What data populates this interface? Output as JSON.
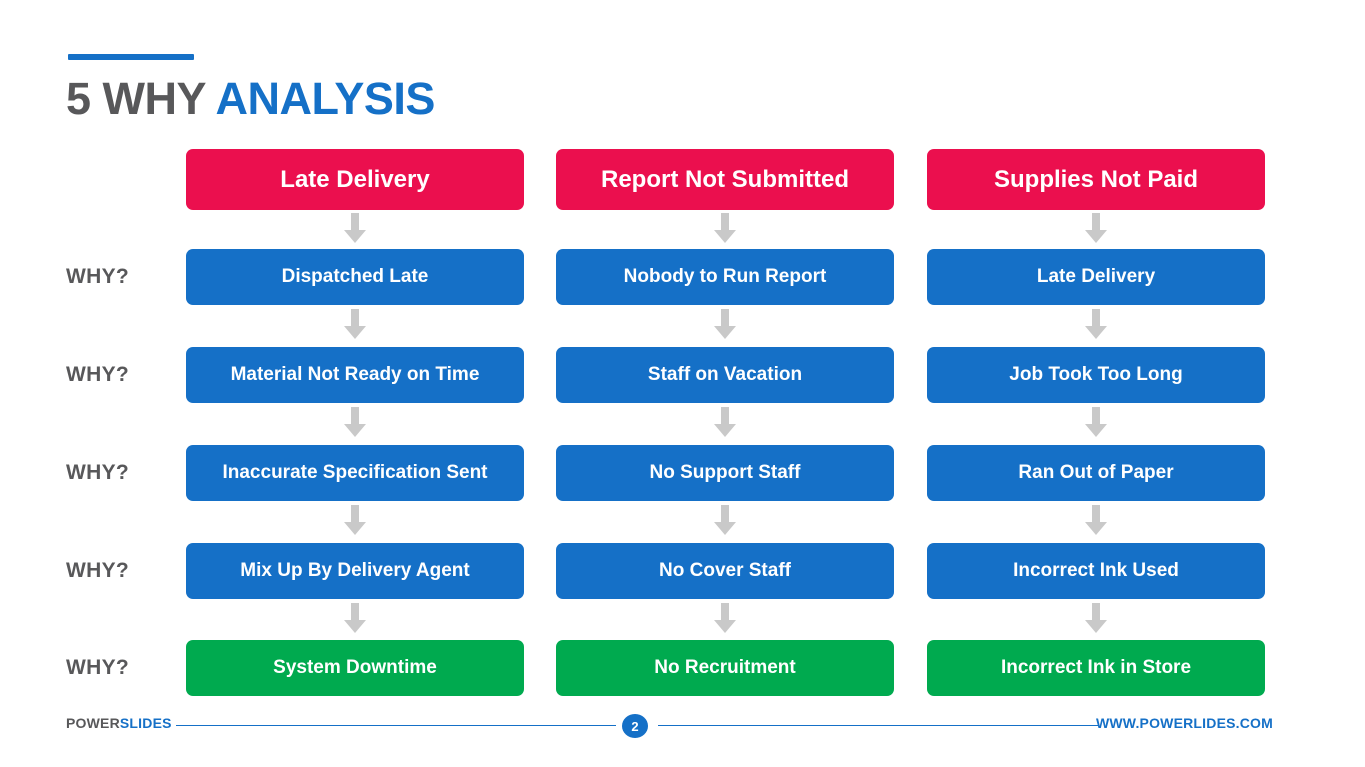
{
  "title": {
    "part_dark": "5 WHY ",
    "part_blue": "ANALYSIS"
  },
  "colors": {
    "accent_blue": "#1570C7",
    "header_crimson": "#EB0F4E",
    "step_blue": "#1570C7",
    "final_green": "#00AA4F",
    "title_gray": "#58585A",
    "arrow_gray": "#C9C9C9"
  },
  "why_labels": [
    "WHY?",
    "WHY?",
    "WHY?",
    "WHY?",
    "WHY?"
  ],
  "columns": [
    {
      "header": "Late Delivery",
      "steps": [
        "Dispatched Late",
        "Material Not Ready on Time",
        "Inaccurate Specification Sent",
        "Mix Up By Delivery Agent"
      ],
      "final": "System Downtime"
    },
    {
      "header": "Report Not Submitted",
      "steps": [
        "Nobody to Run Report",
        "Staff on Vacation",
        "No Support Staff",
        "No Cover Staff"
      ],
      "final": "No Recruitment"
    },
    {
      "header": "Supplies Not Paid",
      "steps": [
        "Late Delivery",
        "Job Took Too Long",
        "Ran Out of Paper",
        "Incorrect Ink Used"
      ],
      "final": "Incorrect Ink in Store"
    }
  ],
  "footer": {
    "brand_dark": "POWER",
    "brand_blue": "SLIDES",
    "page_number": "2",
    "site_url": "WWW.POWERLIDES.COM"
  }
}
